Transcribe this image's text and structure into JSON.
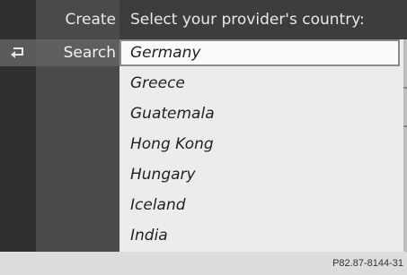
{
  "menu": {
    "items": [
      {
        "label": "Create"
      },
      {
        "label": "Search"
      }
    ]
  },
  "header": {
    "title": "Select your provider's country:"
  },
  "list": {
    "selected_index": 0,
    "items": [
      {
        "label": "Germany"
      },
      {
        "label": "Greece"
      },
      {
        "label": "Guatemala"
      },
      {
        "label": "Hong Kong"
      },
      {
        "label": "Hungary"
      },
      {
        "label": "Iceland"
      },
      {
        "label": "India"
      }
    ]
  },
  "footer": {
    "code": "P82.87-8144-31"
  },
  "icons": {
    "back": "back-arrow-icon"
  }
}
